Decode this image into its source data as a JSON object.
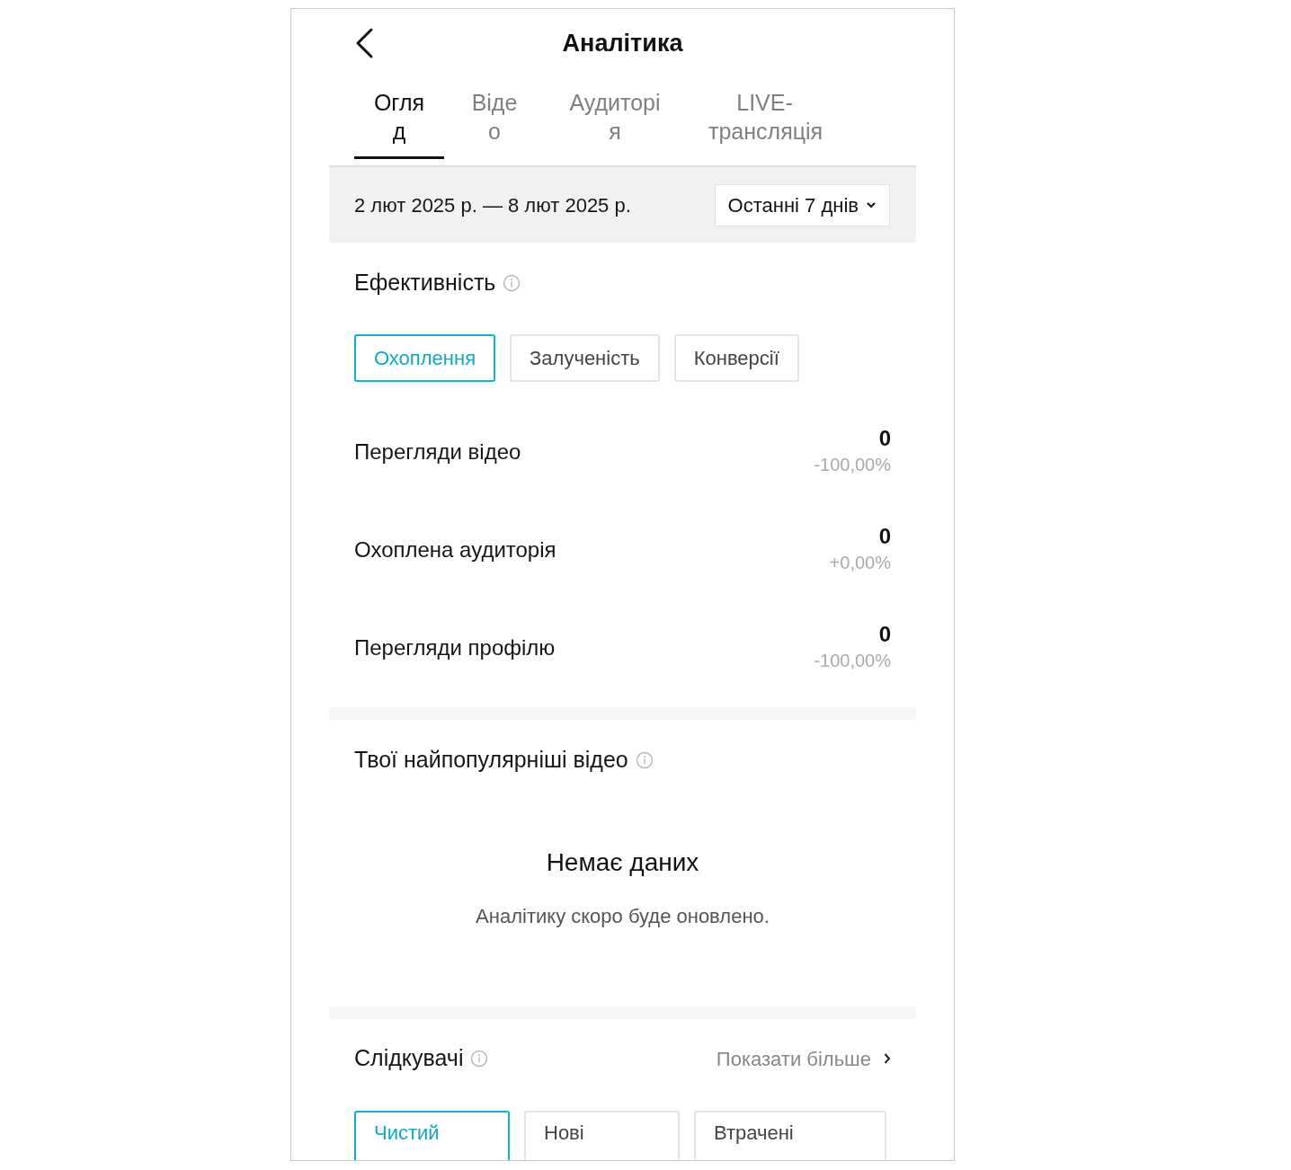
{
  "header": {
    "title": "Аналітика"
  },
  "tabs": [
    {
      "label": "Огляд",
      "selected": true
    },
    {
      "label": "Відео",
      "selected": false
    },
    {
      "label": "Аудиторія",
      "selected": false
    },
    {
      "label": "LIVE-трансляція",
      "selected": false
    }
  ],
  "date_bar": {
    "range": "2 лют 2025 р. — 8 лют 2025 р.",
    "period": "Останні 7 днів"
  },
  "performance": {
    "title": "Ефективність",
    "filters": [
      {
        "label": "Охоплення",
        "selected": true
      },
      {
        "label": "Залученість",
        "selected": false
      },
      {
        "label": "Конверсії",
        "selected": false
      }
    ],
    "metrics": [
      {
        "label": "Перегляди відео",
        "value": "0",
        "change": "-100,00%"
      },
      {
        "label": "Охоплена аудиторія",
        "value": "0",
        "change": "+0,00%"
      },
      {
        "label": "Перегляди профілю",
        "value": "0",
        "change": "-100,00%"
      }
    ]
  },
  "top_videos": {
    "title": "Твої найпопулярніші відео",
    "empty_title": "Немає даних",
    "empty_text": "Аналітику скоро буде оновлено."
  },
  "followers": {
    "title": "Слідкувачі",
    "more": "Показати більше",
    "filters": [
      {
        "label": "Чистий",
        "selected": true
      },
      {
        "label": "Нові",
        "selected": false
      },
      {
        "label": "Втрачені",
        "selected": false
      }
    ]
  }
}
